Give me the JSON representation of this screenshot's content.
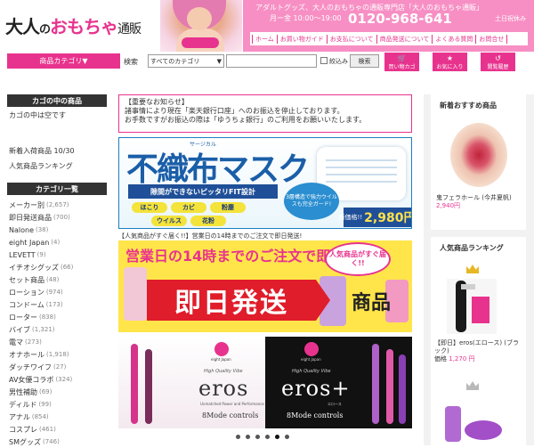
{
  "header": {
    "logo_main": "大人",
    "logo_no": "の",
    "logo_brand": "おもちゃ",
    "logo_suffix": "通販",
    "tagline": "アダルトグッズ、大人のおもちゃの通販専門店「大人のおもちゃ通販」",
    "hours": "月ー金 10:00～19:00",
    "phone": "0120-968-641",
    "closed": "土日祝休み",
    "nav": [
      "ホーム",
      "お買い物ガイド",
      "お支払について",
      "商品発送について",
      "よくある質問",
      "お問合せ"
    ]
  },
  "toolbar": {
    "category_button": "商品カテゴリ▼",
    "search_label": "検索",
    "category_select": "すべてのカテゴリ",
    "narrow_label": "絞込み",
    "search_button": "検索",
    "cart_label": "買い物カゴ",
    "favorites_label": "お気に入り",
    "history_label": "閲覧履歴"
  },
  "sidebar": {
    "cart_heading": "カゴの中の商品",
    "cart_empty": "カゴの中は空です",
    "new_items": "新着入荷商品 10/30",
    "ranking": "人気商品ランキング",
    "category_heading": "カテゴリ一覧",
    "categories": [
      {
        "name": "メーカー別",
        "count": "(2,657)"
      },
      {
        "name": "即日発送商品",
        "count": "(700)"
      },
      {
        "name": "Nalone",
        "count": "(38)"
      },
      {
        "name": "eight Japan",
        "count": "(4)"
      },
      {
        "name": "LEVETT",
        "count": "(9)"
      },
      {
        "name": "イチオシグッズ",
        "count": "(66)"
      },
      {
        "name": "セット商品",
        "count": "(48)"
      },
      {
        "name": "ローション",
        "count": "(974)"
      },
      {
        "name": "コンドーム",
        "count": "(173)"
      },
      {
        "name": "ローター",
        "count": "(838)"
      },
      {
        "name": "バイブ",
        "count": "(1,321)"
      },
      {
        "name": "電マ",
        "count": "(273)"
      },
      {
        "name": "オナホール",
        "count": "(1,918)"
      },
      {
        "name": "ダッチワイフ",
        "count": "(27)"
      },
      {
        "name": "AV女優コラボ",
        "count": "(324)"
      },
      {
        "name": "男性補助",
        "count": "(69)"
      },
      {
        "name": "ディルド",
        "count": "(99)"
      },
      {
        "name": "アナル",
        "count": "(854)"
      },
      {
        "name": "コスプレ",
        "count": "(461)"
      },
      {
        "name": "SMグッズ",
        "count": "(746)"
      }
    ]
  },
  "notice": {
    "title": "【重要なお知らせ】",
    "line1": "諸事情により現在「楽天銀行口座」へのお振込を停止しております。",
    "line2": "お手数ですがお振込の際は「ゆうちょ銀行」のご利用をお願いいたします。"
  },
  "banner_mask": {
    "title": "不織布マスク",
    "ruby": "サージカル",
    "tagline": "隙間ができないピッタリFIT設計",
    "chips": [
      "ほこり",
      "カビ",
      "粉塵",
      "ウイルス",
      "花粉"
    ],
    "circle": "3層構造で強力ウイルスも完全ガード!",
    "price_label": "新価格!!",
    "price": "2,980円"
  },
  "banner_ship": {
    "caption": "【人気商品がすぐ届く!!】営業日の14時までのご注文で即日発送!",
    "top": "営業日の14時までのご注文で即日発送!",
    "badge": "人気商品がすぐ届く!!",
    "band": "即日発送",
    "goods": "商品"
  },
  "banner_eros": {
    "brand": "eight Japan",
    "hq": "High Quality Vibe",
    "name_left": "eros",
    "name_right": "eros+",
    "sub": "Unmatched Power and Performance",
    "sub_right": "エロース",
    "mode": "8Mode controls"
  },
  "right": {
    "new_heading": "新着おすすめ商品",
    "new_product_name": "鬼フェラホール (今井夏帆)",
    "new_product_price": "2,940円",
    "ranking_heading": "人気商品ランキング",
    "rank1_name": "【即日】eros(エロース) (ブラック)",
    "rank1_price_label": "価格",
    "rank1_price": "1,270 円"
  },
  "colors": {
    "brand_pink": "#e8338e",
    "header_pink": "#f78fc4",
    "sidebar_dark": "#333333",
    "mask_blue": "#1a5ea8",
    "ship_yellow": "#ffe54a",
    "ship_red": "#e01d2a"
  },
  "icons": {
    "cart": "cart-icon",
    "favorites": "star-icon",
    "history": "history-icon"
  }
}
